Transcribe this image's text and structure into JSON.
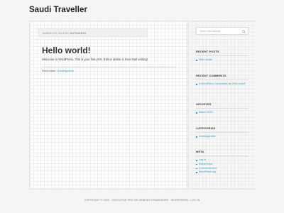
{
  "site": {
    "title": "Saudi Traveller"
  },
  "post": {
    "date": "MARCH 20, 2019",
    "by": "BY",
    "author": "ALFRADESK",
    "title": "Hello world!",
    "body": "Welcome to WordPress. This is your first post. Edit or delete it, then start writing!",
    "filed_label": "Filed Under:",
    "category": "Uncategorized"
  },
  "sidebar": {
    "search_placeholder": "Search this website",
    "recent_posts": {
      "title": "RECENT POSTS",
      "items": [
        "Hello world!"
      ]
    },
    "recent_comments": {
      "title": "RECENT COMMENTS",
      "commenter": "A WordPress Commenter",
      "on": "on",
      "post": "Hello world!"
    },
    "archives": {
      "title": "ARCHIVES",
      "items": [
        "March 2019"
      ]
    },
    "categories": {
      "title": "CATEGORIES",
      "items": [
        "Uncategorized"
      ]
    },
    "meta": {
      "title": "META",
      "items": [
        "Log in",
        "Entries feed",
        "Comments feed",
        "WordPress.org"
      ]
    }
  },
  "footer": {
    "text": "COPYRIGHT © 2020 · EXECUTIVE PRO ON GENESIS FRAMEWORK · WORDPRESS · LOG IN"
  },
  "colors": {
    "link": "#2a9bc3",
    "background": "#f5f5f5"
  }
}
